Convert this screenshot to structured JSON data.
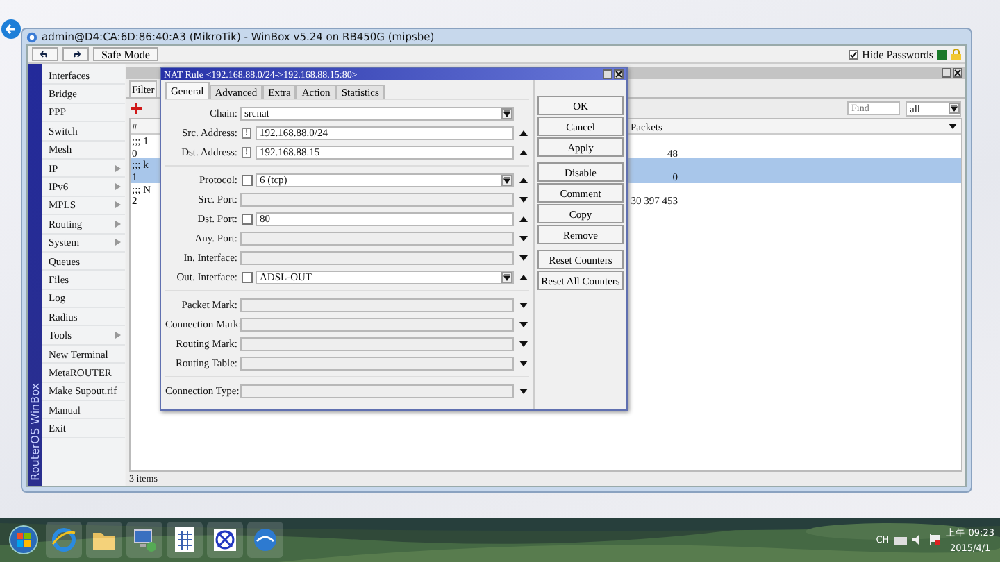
{
  "window": {
    "title": "admin@D4:CA:6D:86:40:A3 (MikroTik) - WinBox v5.24 on RB450G (mipsbe)"
  },
  "toolbar": {
    "safe_mode": "Safe Mode",
    "hide_passwords": {
      "label": "Hide Passwords",
      "checked": true
    }
  },
  "sidebar": {
    "brand": "RouterOS WinBox",
    "items": [
      {
        "label": "Interfaces",
        "submenu": false
      },
      {
        "label": "Bridge",
        "submenu": false
      },
      {
        "label": "PPP",
        "submenu": false
      },
      {
        "label": "Switch",
        "submenu": false
      },
      {
        "label": "Mesh",
        "submenu": false
      },
      {
        "label": "IP",
        "submenu": true
      },
      {
        "label": "IPv6",
        "submenu": true
      },
      {
        "label": "MPLS",
        "submenu": true
      },
      {
        "label": "Routing",
        "submenu": true
      },
      {
        "label": "System",
        "submenu": true
      },
      {
        "label": "Queues",
        "submenu": false
      },
      {
        "label": "Files",
        "submenu": false
      },
      {
        "label": "Log",
        "submenu": false
      },
      {
        "label": "Radius",
        "submenu": false
      },
      {
        "label": "Tools",
        "submenu": true
      },
      {
        "label": "New Terminal",
        "submenu": false
      },
      {
        "label": "MetaROUTER",
        "submenu": false
      },
      {
        "label": "Make Supout.rif",
        "submenu": false
      },
      {
        "label": "Manual",
        "submenu": false
      },
      {
        "label": "Exit",
        "submenu": false
      }
    ]
  },
  "list_window": {
    "tab": "Filter",
    "find": {
      "placeholder": "Find"
    },
    "filter": "all",
    "columns": [
      "#",
      "Packets"
    ],
    "rows": [
      {
        "comment": ";;; 1",
        "number": "0",
        "packets": "48",
        "selected": false
      },
      {
        "comment": ";;; k",
        "number": "1",
        "packets": "0",
        "selected": true
      },
      {
        "comment": ";;; N",
        "number": "2",
        "packets": "30 397 453",
        "selected": false
      }
    ],
    "status": "3 items"
  },
  "dialog": {
    "title": "NAT Rule <192.168.88.0/24->192.168.88.15:80>",
    "tabs": [
      {
        "label": "General",
        "selected": true
      },
      {
        "label": "Advanced",
        "selected": false
      },
      {
        "label": "Extra",
        "selected": false
      },
      {
        "label": "Action",
        "selected": false
      },
      {
        "label": "Statistics",
        "selected": false
      }
    ],
    "groups": [
      [
        {
          "label": "Chain:",
          "value": "srcnat",
          "dropdown": true
        },
        {
          "label": "Src. Address:",
          "invert": "!",
          "value": "192.168.88.0/24",
          "expanded": true
        },
        {
          "label": "Dst. Address:",
          "invert": "!",
          "value": "192.168.88.15",
          "expanded": true
        }
      ],
      [
        {
          "label": "Protocol:",
          "checkbox": false,
          "value": "6 (tcp)",
          "dropdown": true,
          "expanded": true
        },
        {
          "label": "Src. Port:",
          "expanded": false
        },
        {
          "label": "Dst. Port:",
          "checkbox": false,
          "value": "80",
          "expanded": true
        },
        {
          "label": "Any. Port:",
          "expanded": false
        },
        {
          "label": "In. Interface:",
          "expanded": false
        },
        {
          "label": "Out. Interface:",
          "checkbox": false,
          "value": "ADSL-OUT",
          "dropdown": true,
          "expanded": true
        }
      ],
      [
        {
          "label": "Packet Mark:",
          "expanded": false
        },
        {
          "label": "Connection Mark:",
          "expanded": false
        },
        {
          "label": "Routing Mark:",
          "expanded": false
        },
        {
          "label": "Routing Table:",
          "expanded": false
        }
      ],
      [
        {
          "label": "Connection Type:",
          "expanded": false
        }
      ]
    ],
    "button_groups": [
      [
        "OK",
        "Cancel",
        "Apply"
      ],
      [
        "Disable",
        "Comment",
        "Copy",
        "Remove"
      ],
      [
        "Reset Counters",
        "Reset All Counters"
      ]
    ]
  },
  "taskbar": {
    "language": "CH",
    "time": "上午 09:23",
    "date": "2015/4/1"
  }
}
